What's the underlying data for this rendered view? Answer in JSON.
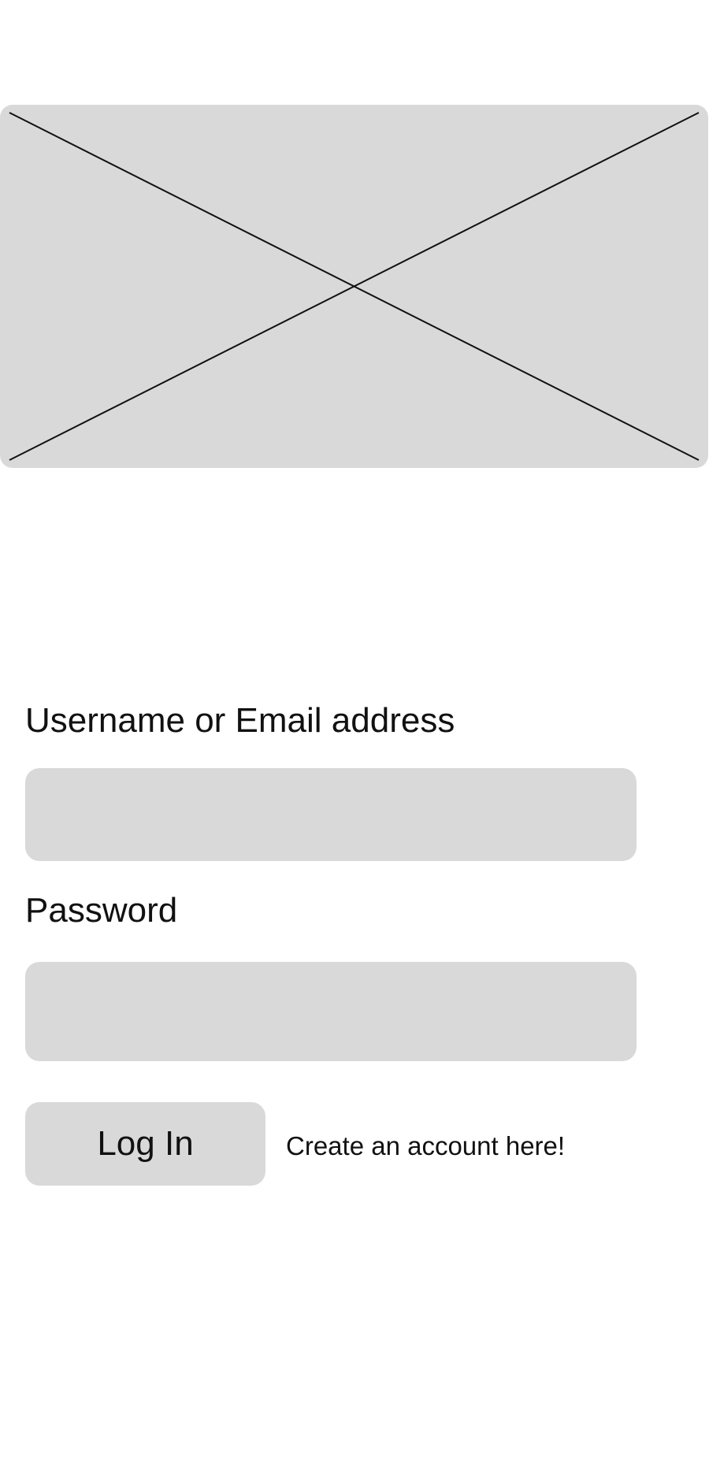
{
  "hero": {
    "icon": "image-placeholder-icon",
    "background_color": "#d9d9d9"
  },
  "form": {
    "username_label": "Username or Email address",
    "username_value": "",
    "password_label": "Password",
    "password_value": "",
    "login_label": "Log In",
    "create_account_label": "Create an account here!"
  },
  "colors": {
    "field_background": "#d9d9d9",
    "text": "#111111",
    "page_background": "#ffffff"
  }
}
